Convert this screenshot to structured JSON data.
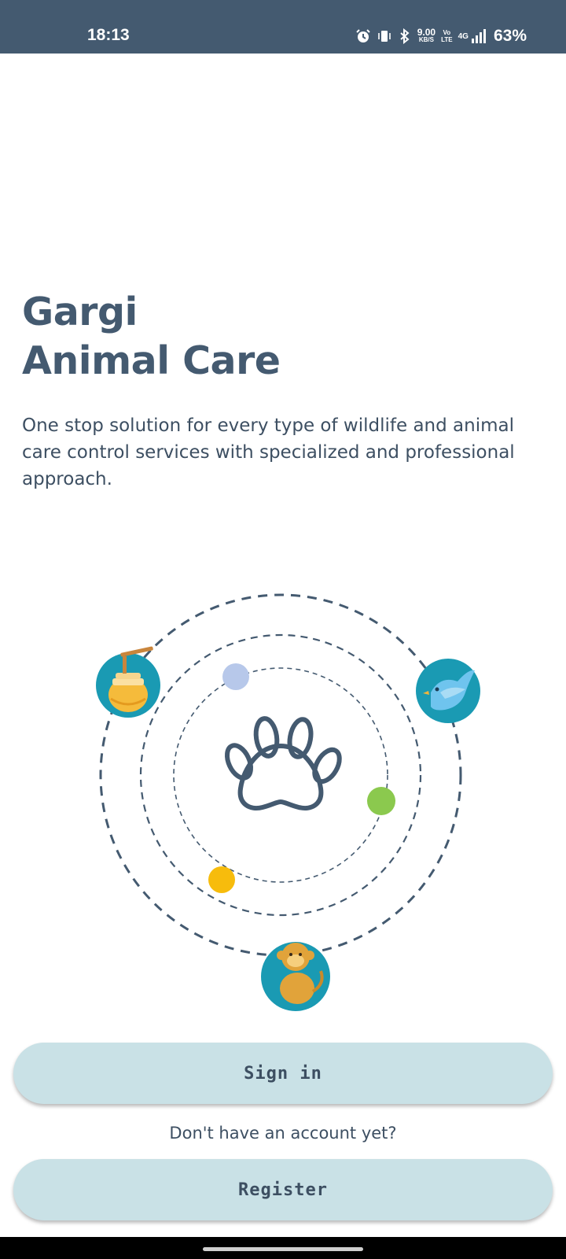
{
  "status_bar": {
    "time": "18:13",
    "net_speed_value": "9.00",
    "net_speed_unit": "KB/S",
    "volte_top": "Vo",
    "volte_bottom": "LTE",
    "network": "4G",
    "battery": "63%",
    "icons": [
      "alarm-icon",
      "vibrate-icon",
      "bluetooth-icon",
      "signal-icon"
    ]
  },
  "hero": {
    "title_line1": "Gargi",
    "title_line2": "Animal Care",
    "tagline": "One stop solution for every type of wildlife and animal care control services with specialized and professional approach."
  },
  "illustration": {
    "center_icon": "paw-icon",
    "orbit_icons": [
      "honey-pot-icon",
      "bird-icon",
      "monkey-icon"
    ],
    "dot_colors": [
      "#b7c8ea",
      "#8bc94e",
      "#f7bc0c"
    ],
    "accent_color": "#445a70",
    "badge_color": "#1a9ab3"
  },
  "auth": {
    "signin_label": "Sign in",
    "no_account_text": "Don't have an account yet?",
    "register_label": "Register"
  },
  "colors": {
    "status_bar": "#445a70",
    "button_bg": "#c9e1e6",
    "text_primary": "#445a70"
  }
}
